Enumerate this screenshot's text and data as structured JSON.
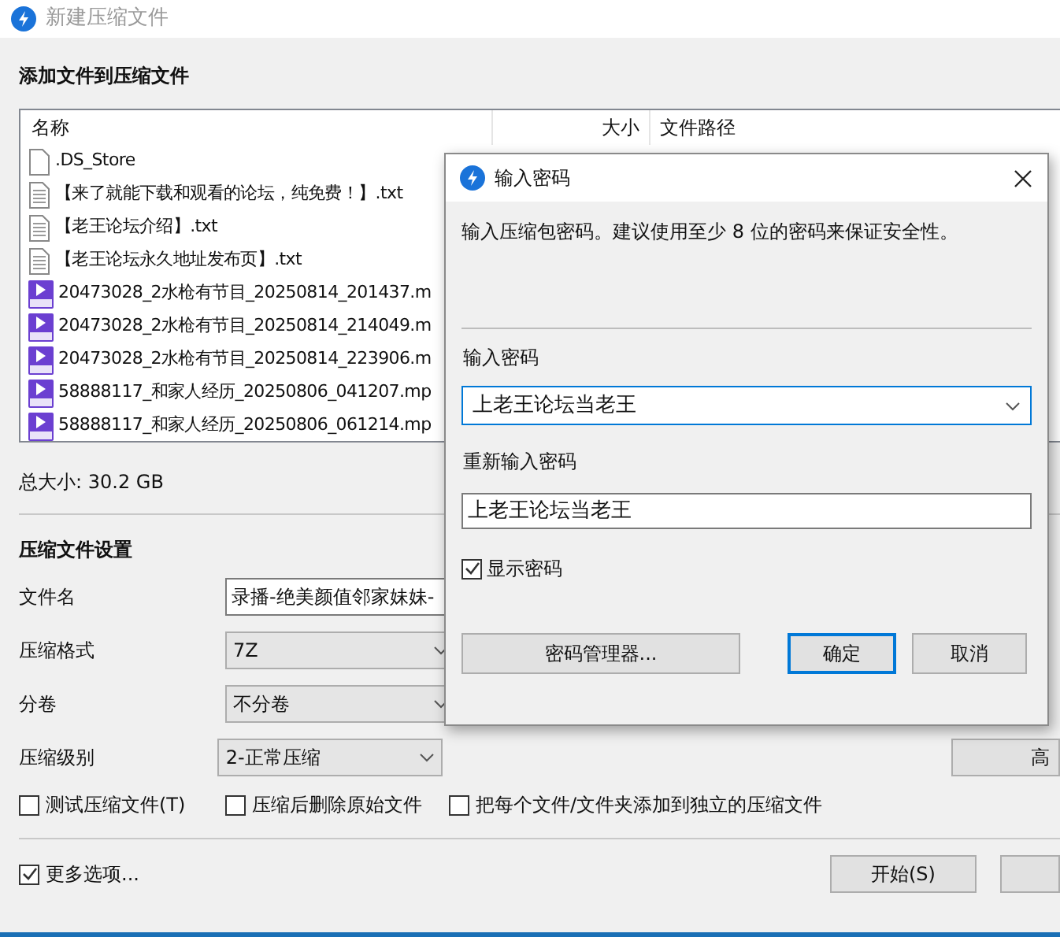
{
  "window": {
    "title": "新建压缩文件"
  },
  "files_section": {
    "heading": "添加文件到压缩文件",
    "columns": [
      "名称",
      "大小",
      "文件路径"
    ],
    "files": [
      {
        "name": ".DS_Store",
        "kind": "blank"
      },
      {
        "name": "【来了就能下载和观看的论坛，纯免费！】.txt",
        "kind": "text"
      },
      {
        "name": "【老王论坛介绍】.txt",
        "kind": "text"
      },
      {
        "name": "【老王论坛永久地址发布页】.txt",
        "kind": "text"
      },
      {
        "name": "20473028_2水枪有节目_20250814_201437.m",
        "kind": "video"
      },
      {
        "name": "20473028_2水枪有节目_20250814_214049.m",
        "kind": "video"
      },
      {
        "name": "20473028_2水枪有节目_20250814_223906.m",
        "kind": "video"
      },
      {
        "name": "58888117_和家人经历_20250806_041207.mp",
        "kind": "video"
      },
      {
        "name": "58888117_和家人经历_20250806_061214.mp",
        "kind": "video"
      }
    ],
    "total_size": "总大小: 30.2 GB"
  },
  "settings": {
    "heading": "压缩文件设置",
    "fields": [
      {
        "label": "文件名",
        "kind": "text",
        "value": "录播-绝美颜值邻家妹妹-"
      },
      {
        "label": "压缩格式",
        "kind": "select",
        "value": "7Z"
      },
      {
        "label": "分卷",
        "kind": "select",
        "value": "不分卷"
      },
      {
        "label": "压缩级别",
        "kind": "select",
        "value": "2-正常压缩"
      }
    ],
    "advanced_button": "高",
    "options": [
      {
        "label": "测试压缩文件(T)",
        "checked": false
      },
      {
        "label": "压缩后删除原始文件",
        "checked": false
      },
      {
        "label": "把每个文件/文件夹添加到独立的压缩文件",
        "checked": false
      }
    ]
  },
  "more_options": {
    "label": "更多选项...",
    "checked": true
  },
  "start_button": "开始(S)",
  "dialog": {
    "title": "输入密码",
    "description": "输入压缩包密码。建议使用至少 8 位的密码来保证安全性。",
    "password_label": "输入密码",
    "password": "上老王论坛当老王",
    "confirm_label": "重新输入密码",
    "confirm": "上老王论坛当老王",
    "show_password": {
      "label": "显示密码",
      "checked": true
    },
    "buttons": [
      {
        "label": "密码管理器...",
        "default": false
      },
      {
        "label": "确定",
        "default": true
      },
      {
        "label": "取消",
        "default": false
      }
    ]
  }
}
